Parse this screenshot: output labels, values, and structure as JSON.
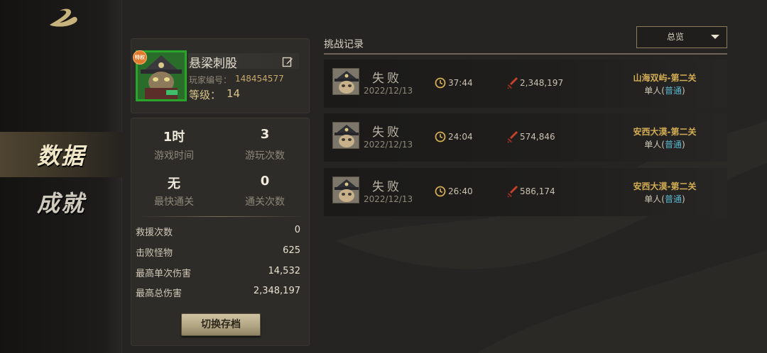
{
  "nav": {
    "items": [
      {
        "label": "数据",
        "active": true
      },
      {
        "label": "成就",
        "active": false
      }
    ]
  },
  "profile": {
    "badge": "特权",
    "name": "悬梁刺股",
    "player_id_label": "玩家编号：",
    "player_id": "148454577",
    "level_label": "等级：",
    "level": "14"
  },
  "stats": {
    "play_time": {
      "value": "1时",
      "label": "游戏时间"
    },
    "play_count": {
      "value": "3",
      "label": "游玩次数"
    },
    "fastest_clear": {
      "value": "无",
      "label": "最快通关"
    },
    "clear_count": {
      "value": "0",
      "label": "通关次数"
    },
    "rows": [
      {
        "label": "救援次数",
        "value": "0"
      },
      {
        "label": "击败怪物",
        "value": "625"
      },
      {
        "label": "最高单次伤害",
        "value": "14,532"
      },
      {
        "label": "最高总伤害",
        "value": "2,348,197"
      }
    ],
    "switch_button": "切换存档"
  },
  "records": {
    "title": "挑战记录",
    "filter": "总览",
    "items": [
      {
        "result": "失败",
        "date": "2022/12/13",
        "time": "37:44",
        "damage": "2,348,197",
        "stage": "山海双屿-第二关",
        "mode": "单人(",
        "difficulty": "普通",
        "mode_end": ")"
      },
      {
        "result": "失败",
        "date": "2022/12/13",
        "time": "24:04",
        "damage": "574,846",
        "stage": "安西大漠-第二关",
        "mode": "单人(",
        "difficulty": "普通",
        "mode_end": ")"
      },
      {
        "result": "失败",
        "date": "2022/12/13",
        "time": "26:40",
        "damage": "586,174",
        "stage": "安西大漠-第二关",
        "mode": "单人(",
        "difficulty": "普通",
        "mode_end": ")"
      }
    ]
  },
  "colors": {
    "accent_gold": "#d3ad53",
    "difficulty_blue": "#5bb7cf",
    "avatar_border_green": "#2aa52b"
  }
}
